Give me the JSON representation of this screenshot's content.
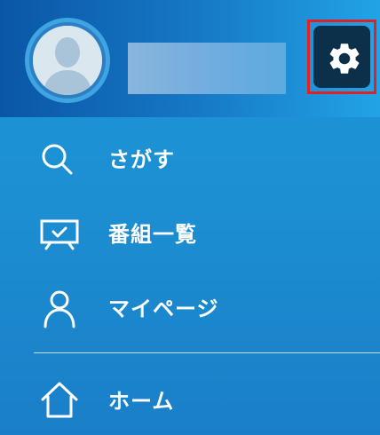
{
  "header": {
    "avatar_icon": "user-silhouette-icon",
    "username": "",
    "settings_icon": "gear-icon"
  },
  "menu": {
    "items": [
      {
        "label": "さがす",
        "icon": "search-icon"
      },
      {
        "label": "番組一覧",
        "icon": "tv-check-icon"
      },
      {
        "label": "マイページ",
        "icon": "person-icon"
      }
    ],
    "home": {
      "label": "ホーム",
      "icon": "home-icon"
    }
  },
  "colors": {
    "header_start": "#0a56a6",
    "header_end": "#22a3e6",
    "background": "#1c8fd2",
    "settings_bg": "#0c2f4a",
    "highlight_border": "#e12222",
    "text": "#ffffff"
  }
}
